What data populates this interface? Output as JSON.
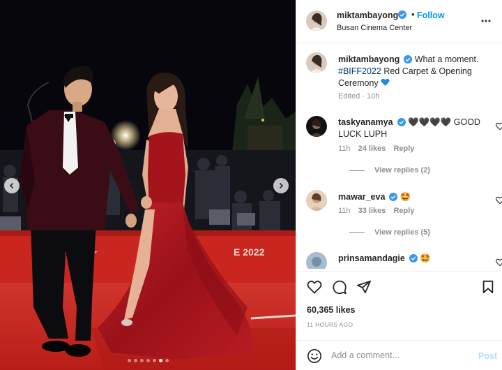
{
  "post": {
    "author": "miktambayong",
    "follow_label": "Follow",
    "separator": "•",
    "location": "Busan Cinema Center"
  },
  "caption": {
    "author": "miktambayong",
    "text_before": "What a moment.",
    "hashtag": "#BIFF2022",
    "text_after": "Red Carpet & Opening Ceremony",
    "edited": "Edited · 10h"
  },
  "comments": [
    {
      "author": "taskyanamya",
      "text": "🖤🖤🖤🖤 GOOD LUCK LUPH",
      "time": "11h",
      "likes": "24 likes",
      "reply_label": "Reply",
      "view_replies": "View replies (2)"
    },
    {
      "author": "mawar_eva",
      "text": "🤩",
      "time": "11h",
      "likes": "33 likes",
      "reply_label": "Reply",
      "view_replies": "View replies (5)"
    },
    {
      "author": "prinsamandagie",
      "text": "🤩"
    }
  ],
  "actions": {
    "like_icon": "heart-icon",
    "comment_icon": "comment-icon",
    "share_icon": "share-icon",
    "save_icon": "bookmark-icon",
    "likes": "60,365 likes",
    "posted": "11 HOURS AGO"
  },
  "add_comment": {
    "placeholder": "Add a comment...",
    "post_label": "Post",
    "emoji_icon": "smiley-icon"
  },
  "carousel": {
    "total": 7,
    "active_index": 5
  },
  "colors": {
    "accent": "#0095f6",
    "verified": "#3897f0",
    "post_disabled": "#b2dffc",
    "muted": "#8e8e8e",
    "carpet": "#c0221c",
    "dress": "#a8141c"
  }
}
